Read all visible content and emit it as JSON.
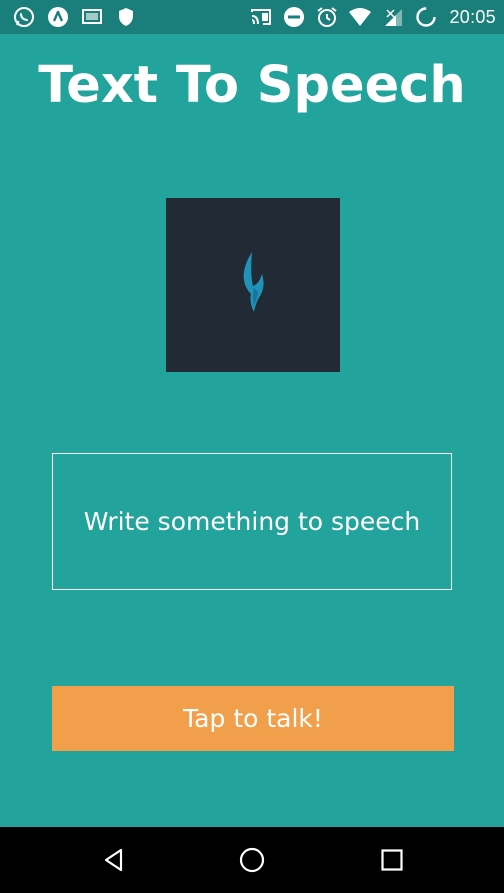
{
  "status_bar": {
    "time": "20:05",
    "left_icons": [
      "whatsapp-icon",
      "app-drawer-icon",
      "cast-screen-icon",
      "shield-icon"
    ],
    "right_icons": [
      "cast-icon",
      "do-not-disturb-icon",
      "alarm-icon",
      "wifi-icon",
      "cell-signal-icon",
      "battery-charging-icon"
    ]
  },
  "app": {
    "title": "Text To Speech",
    "logo_icon": "flame-icon",
    "input_placeholder": "Write something to speech",
    "input_value": "",
    "talk_button_label": "Tap to talk!"
  },
  "colors": {
    "background": "#22a39c",
    "status_bar": "#1a7f7a",
    "logo_box": "#222a35",
    "flame": "#1f93b8",
    "button": "#f29f4b",
    "nav_bar": "#000000"
  },
  "nav_bar": {
    "buttons": [
      "back-icon",
      "home-icon",
      "recents-icon"
    ]
  }
}
